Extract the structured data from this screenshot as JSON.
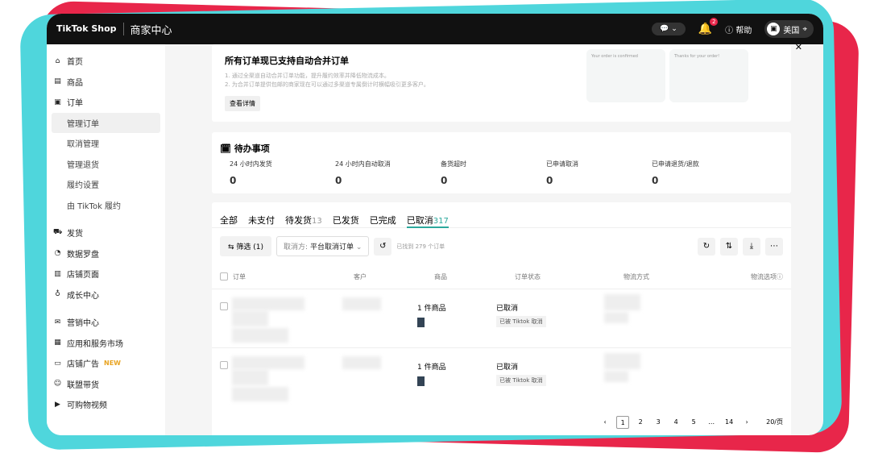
{
  "header": {
    "logo": "TikTok Shop",
    "title": "商家中心",
    "notif_count": "2",
    "help": "帮助",
    "region": "美国"
  },
  "sidebar": {
    "items": [
      {
        "label": "首页",
        "icon": "⌂"
      },
      {
        "label": "商品",
        "icon": "▤"
      },
      {
        "label": "订单",
        "icon": "▣"
      },
      {
        "label": "管理订单",
        "sub": true,
        "active": true
      },
      {
        "label": "取消管理",
        "sub": true
      },
      {
        "label": "管理退货",
        "sub": true
      },
      {
        "label": "履约设置",
        "sub": true
      },
      {
        "label": "由 TikTok 履约",
        "sub": true
      },
      {
        "label": "发货",
        "icon": "⛟"
      },
      {
        "label": "数据罗盘",
        "icon": "◔"
      },
      {
        "label": "店铺页面",
        "icon": "▥"
      },
      {
        "label": "成长中心",
        "icon": "♁"
      },
      {
        "label": "营销中心",
        "icon": "✉"
      },
      {
        "label": "应用和服务市场",
        "icon": "▦"
      },
      {
        "label": "店铺广告",
        "icon": "▭",
        "badge": "NEW"
      },
      {
        "label": "联盟带货",
        "icon": "☺"
      },
      {
        "label": "可购物视频",
        "icon": "▶"
      }
    ]
  },
  "banner": {
    "title": "所有订单现已支持自动合并订单",
    "line1": "1. 通过全渠道自动合并订单功能，提升履约效率并降低物流成本。",
    "line2": "2. 为合并订单提供包邮的商家现在可以通过多渠道专属倒计时横幅吸引更多客户。",
    "button": "查看详情",
    "preview1": "Your order is confirmed",
    "preview2": "Thanks for your order!"
  },
  "todo": {
    "title": "待办事项",
    "items": [
      {
        "label": "24 小时内发货",
        "value": "0"
      },
      {
        "label": "24 小时内自动取消",
        "value": "0"
      },
      {
        "label": "备货超时",
        "value": "0"
      },
      {
        "label": "已申请取消",
        "value": "0"
      },
      {
        "label": "已申请退货/退款",
        "value": "0"
      }
    ]
  },
  "tabs": [
    {
      "label": "全部",
      "count": ""
    },
    {
      "label": "未支付",
      "count": ""
    },
    {
      "label": "待发货",
      "count": "13"
    },
    {
      "label": "已发货",
      "count": ""
    },
    {
      "label": "已完成",
      "count": ""
    },
    {
      "label": "已取消",
      "count": "317",
      "active": true
    }
  ],
  "toolbar": {
    "filter": "筛选 (1)",
    "cancel_label": "取消方:",
    "cancel_value": "平台取消订单",
    "found": "已找到 279 个订单"
  },
  "columns": [
    "订单",
    "客户",
    "商品",
    "订单状态",
    "物流方式",
    "物流选项"
  ],
  "rows": [
    {
      "product": "1 件商品",
      "status": "已取消",
      "tag": "已被 Tiktok 取消"
    },
    {
      "product": "1 件商品",
      "status": "已取消",
      "tag": "已被 Tiktok 取消"
    }
  ],
  "pagination": {
    "pages": [
      "1",
      "2",
      "3",
      "4",
      "5",
      "…",
      "14"
    ],
    "current": "1",
    "per_page": "20/页"
  }
}
